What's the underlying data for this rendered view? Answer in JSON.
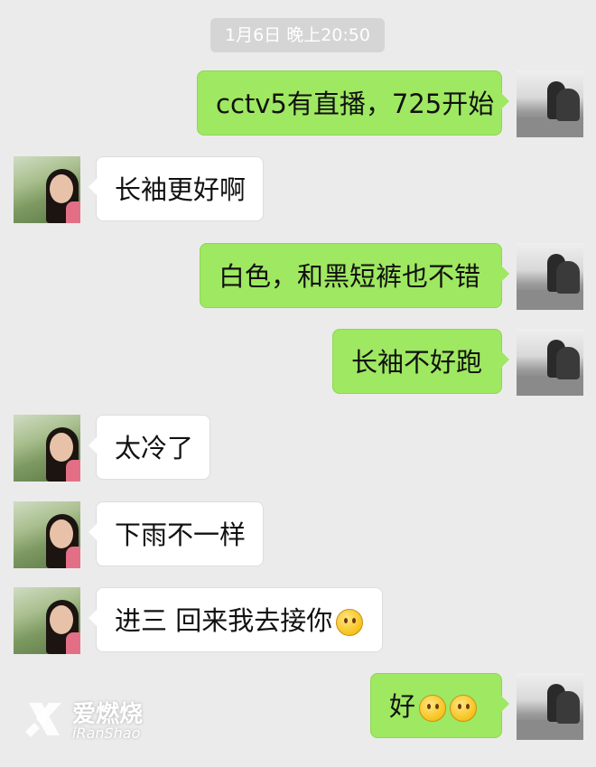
{
  "timestamp": "1月6日 晚上20:50",
  "messages": [
    {
      "side": "out",
      "text": "cctv5有直播，725开始"
    },
    {
      "side": "in",
      "text": "长袖更好啊"
    },
    {
      "side": "out",
      "text": "白色，和黑短裤也不错"
    },
    {
      "side": "out",
      "text": "长袖不好跑"
    },
    {
      "side": "in",
      "text": "太冷了"
    },
    {
      "side": "in",
      "text": "下雨不一样"
    },
    {
      "side": "in",
      "text": "进三 回来我去接你",
      "emoji": [
        "smile-emoji"
      ]
    },
    {
      "side": "out",
      "text": "好",
      "emoji": [
        "kiss-emoji",
        "kiss-emoji"
      ]
    }
  ],
  "watermark": {
    "name_cn": "爱燃烧",
    "name_en": "iRanShao"
  },
  "colors": {
    "background": "#ebebeb",
    "outgoing_bubble": "#9fe861",
    "incoming_bubble": "#ffffff",
    "timestamp_pill": "#d5d5d5"
  }
}
